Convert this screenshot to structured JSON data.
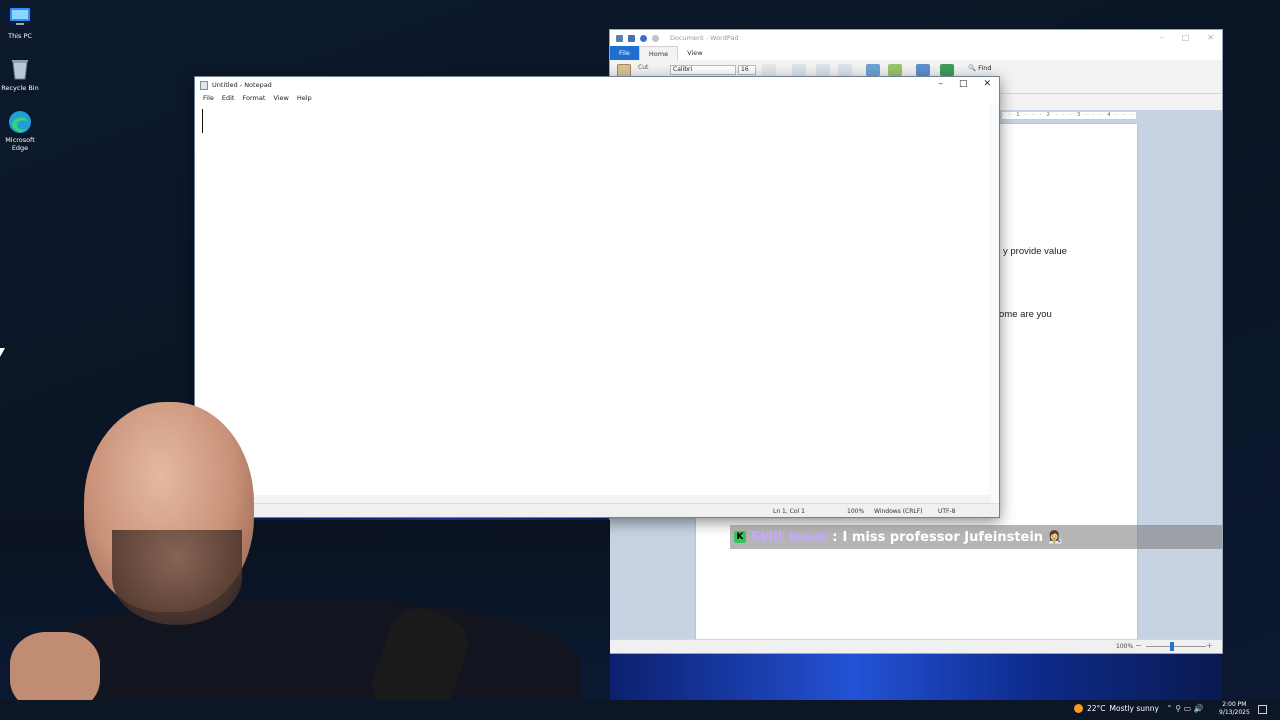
{
  "desktop": {
    "icons": [
      {
        "label": "This PC"
      },
      {
        "label": "Recycle Bin"
      },
      {
        "label": "Microsoft Edge"
      }
    ]
  },
  "wordpad": {
    "title": "Document - WordPad",
    "tabs": {
      "file": "File",
      "home": "Home",
      "view": "View"
    },
    "ribbon": {
      "cut": "Cut",
      "font": "Calibri",
      "size": "16",
      "find": "Find"
    },
    "ruler": "· · 1 · · · 2 · · · 3 · · · 4 · · · 5 · · · 6 · · · 7 ·",
    "doc_lines": [
      "y provide value",
      "ome are you"
    ],
    "zoom": "100%",
    "minus": "−",
    "plus": "+"
  },
  "notepad": {
    "title": "Untitled - Notepad",
    "menu": {
      "file": "File",
      "edit": "Edit",
      "format": "Format",
      "view": "View",
      "help": "Help"
    },
    "status": {
      "position": "Ln 1, Col 1",
      "zoom": "100%",
      "line_ending": "Windows (CRLF)",
      "encoding": "UTF-8"
    },
    "controls": {
      "minimize": "–",
      "maximize": "□",
      "close": "✕"
    }
  },
  "chat": {
    "badge": "K",
    "username": "Skill_Issue",
    "separator": ":",
    "message": "I miss professor Jufeinstein",
    "emoji": "👩‍🔬"
  },
  "taskbar": {
    "weather_temp": "22°C",
    "weather_desc": "Mostly sunny",
    "tray_icons": "⌃  ⚲  ▭  🔊",
    "time": "2:00 PM",
    "date": "9/13/2025"
  },
  "colors": {
    "wordpad_file_tab": "#1e6fd0",
    "chat_username": "#c7a6ff",
    "kick_badge": "#39c45a"
  }
}
